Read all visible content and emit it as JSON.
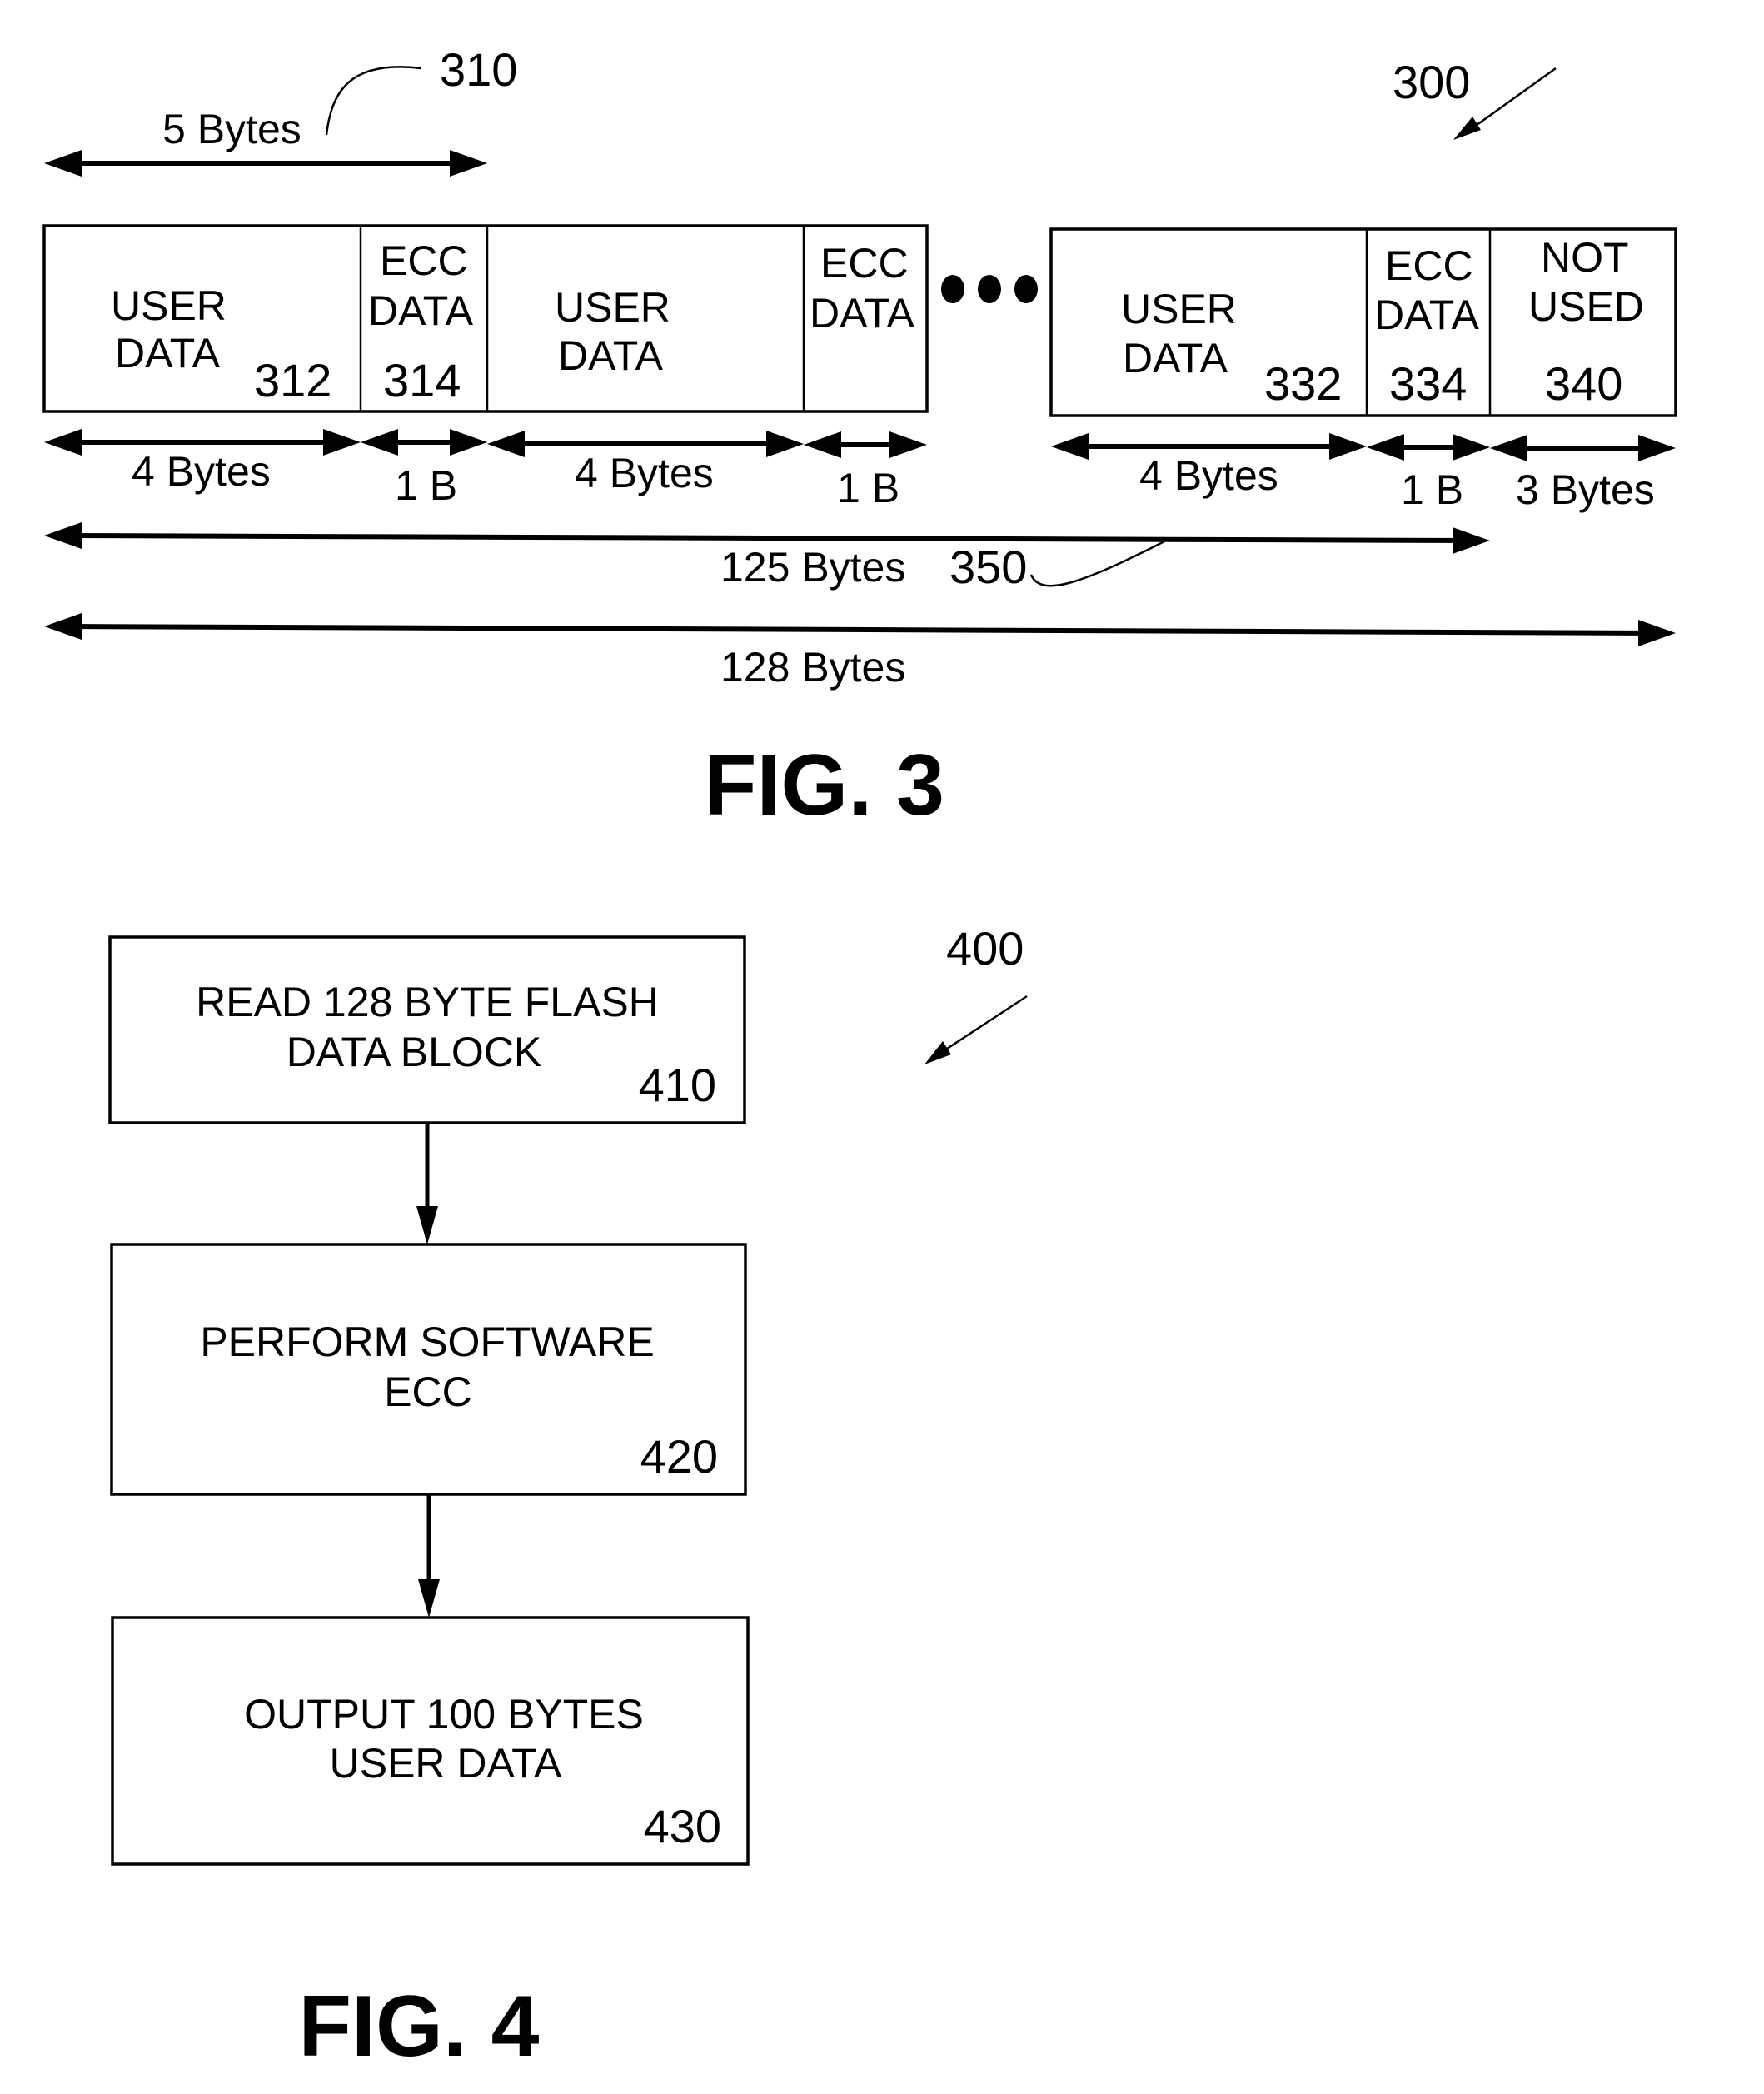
{
  "fig3": {
    "ref_number": "300",
    "caption": "FIG. 3",
    "group_ref": "310",
    "group_span_label": "5 Bytes",
    "cells": [
      {
        "lines": [
          "USER",
          "DATA"
        ],
        "ref": "312",
        "size_label": "4 Bytes"
      },
      {
        "lines": [
          "ECC",
          "DATA"
        ],
        "ref": "314",
        "size_label": "1 B"
      },
      {
        "lines": [
          "USER",
          "DATA"
        ],
        "ref": "",
        "size_label": "4 Bytes"
      },
      {
        "lines": [
          "ECC",
          "DATA"
        ],
        "ref": "",
        "size_label": "1 B"
      },
      {
        "lines": [
          "USER",
          "DATA"
        ],
        "ref": "332",
        "size_label": "4 Bytes"
      },
      {
        "lines": [
          "ECC",
          "DATA"
        ],
        "ref": "334",
        "size_label": "1 B"
      },
      {
        "lines": [
          "NOT",
          "USED"
        ],
        "ref": "340",
        "size_label": "3 Bytes"
      }
    ],
    "ellipsis": "•••",
    "span_125": {
      "label": "125 Bytes",
      "ref": "350"
    },
    "span_128": {
      "label": "128 Bytes"
    }
  },
  "fig4": {
    "ref_number": "400",
    "caption": "FIG. 4",
    "steps": [
      {
        "lines": [
          "READ 128 BYTE FLASH",
          "DATA BLOCK"
        ],
        "ref": "410"
      },
      {
        "lines": [
          "PERFORM SOFTWARE",
          "ECC"
        ],
        "ref": "420"
      },
      {
        "lines": [
          "OUTPUT 100 BYTES",
          "USER DATA"
        ],
        "ref": "430"
      }
    ]
  }
}
